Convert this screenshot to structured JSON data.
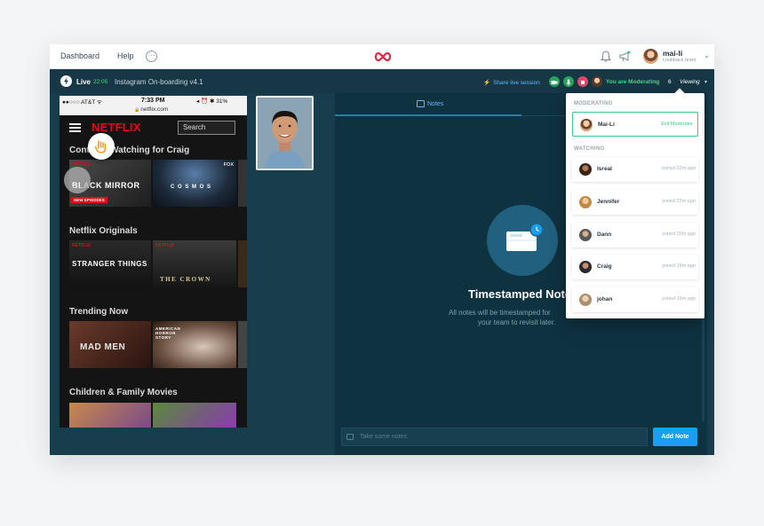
{
  "nav": {
    "dashboard": "Dashboard",
    "help": "Help",
    "more": "···",
    "user_name": "mai-li",
    "user_team": "Lookback team"
  },
  "session": {
    "live_label": "Live",
    "live_time": "22:05",
    "title": "Instagram On-boarding v4.1",
    "share": "Share live session",
    "moderating": "You are Moderating",
    "viewer_count": "6",
    "viewing": "Viewing"
  },
  "phone": {
    "carrier": "●●○○○ AT&T ᯤ",
    "time": "7:33 PM",
    "battery": "◂ ⏰ ✱ 31%",
    "url": "netflix.com",
    "logo": "NETFLIX",
    "search_placeholder": "Search",
    "rows": [
      {
        "title": "Continue Watching for Craig",
        "tiles": [
          {
            "label": "BLACK MIRROR",
            "badge": "NETFLIX",
            "tag": "NEW EPISODES"
          },
          {
            "label": "C O S M O S",
            "corner": "FOX"
          }
        ]
      },
      {
        "title": "Netflix Originals",
        "tiles": [
          {
            "label": "STRANGER THINGS",
            "badge": "NETFLIX"
          },
          {
            "label": "THE CROWN",
            "badge": "NETFLIX"
          }
        ]
      },
      {
        "title": "Trending Now",
        "tiles": [
          {
            "label": "MAD MEN"
          },
          {
            "label": "AMERICAN HORROR STORY"
          }
        ]
      },
      {
        "title": "Children & Family Movies",
        "tiles": [
          {
            "label": ""
          },
          {
            "label": ""
          }
        ]
      }
    ]
  },
  "notes": {
    "tab_label": "Notes",
    "empty_title": "Timestamped Notes",
    "empty_desc_line1": "All notes will be timestamped for",
    "empty_desc_line2": "your team to revisit later.",
    "input_placeholder": "Take some notes",
    "add_button": "Add Note"
  },
  "viewers": {
    "moderating_label": "MODERATING",
    "watching_label": "WATCHING",
    "moderator": {
      "name": "Mai-Li",
      "action": "Exit Moderator"
    },
    "watching": [
      {
        "name": "Isreal",
        "joined": "joined 22m ago"
      },
      {
        "name": "Jennifer",
        "joined": "joined 22m ago"
      },
      {
        "name": "Dann",
        "joined": "joined 20m ago"
      },
      {
        "name": "Craig",
        "joined": "joined 19m ago"
      },
      {
        "name": "johan",
        "joined": "joined 19m ago"
      }
    ]
  },
  "colors": {
    "app_bg": "#173c4c",
    "accent_blue": "#1a9ff0",
    "live_green": "#3ddc84",
    "netflix_red": "#e50914"
  },
  "icons": [
    "bell-icon",
    "megaphone-icon",
    "infinity-logo-icon",
    "bolt-icon",
    "camera-icon",
    "mic-icon",
    "record-icon",
    "hand-cursor-icon",
    "notes-icon",
    "chevron-down-icon"
  ]
}
